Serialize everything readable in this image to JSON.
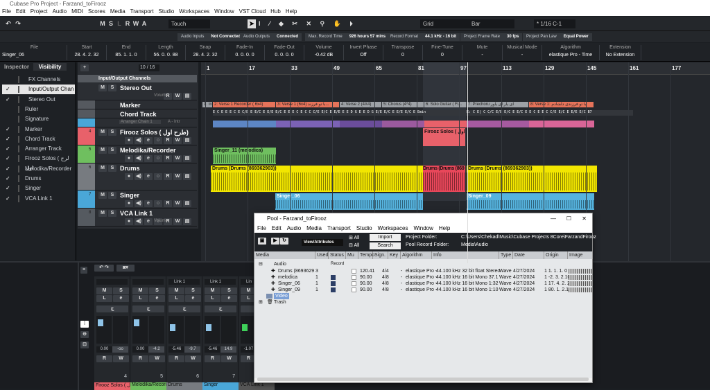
{
  "app": {
    "title": "Cubase Pro Project - Farzand_toFirooz"
  },
  "menu": [
    "File",
    "Edit",
    "Project",
    "Audio",
    "MIDI",
    "Scores",
    "Media",
    "Transport",
    "Studio",
    "Workspaces",
    "Window",
    "VST Cloud",
    "Hub",
    "Help"
  ],
  "toolbar": {
    "msl": [
      "M",
      "S",
      "L",
      "R",
      "W",
      "A"
    ],
    "automation_mode": "Touch",
    "snap_type": "Grid",
    "grid_type": "Bar",
    "quantize": "* 1/16  C-1"
  },
  "status": [
    {
      "label": "Audio Inputs",
      "value": "Not Connected"
    },
    {
      "label": "Audio Outputs",
      "value": "Connected"
    },
    {
      "label": "Max. Record Time",
      "value": "926 hours 57 mins"
    },
    {
      "label": "Record Format",
      "value": "44.1 kHz - 16 bit"
    },
    {
      "label": "Project Frame Rate",
      "value": "30 fps"
    },
    {
      "label": "Project Pan Law",
      "value": "Equal Power"
    }
  ],
  "infoline": [
    {
      "h": "File",
      "v": "Singer_06"
    },
    {
      "h": "Start",
      "v": "28. 4. 2. 32"
    },
    {
      "h": "End",
      "v": "85. 1. 1. 0"
    },
    {
      "h": "Length",
      "v": "56. 0. 0. 88"
    },
    {
      "h": "Snap",
      "v": "28. 4. 2. 32"
    },
    {
      "h": "Fade-In",
      "v": "0. 0. 0. 0"
    },
    {
      "h": "Fade-Out",
      "v": "0. 0. 0. 0"
    },
    {
      "h": "Volume",
      "v": "-0.42   dB"
    },
    {
      "h": "Invert Phase",
      "v": "Off"
    },
    {
      "h": "Transpose",
      "v": "0"
    },
    {
      "h": "Fine-Tune",
      "v": "0"
    },
    {
      "h": "Mute",
      "v": "-"
    },
    {
      "h": "Musical Mode",
      "v": "-"
    },
    {
      "h": "Algorithm",
      "v": "elastique Pro - Time"
    },
    {
      "h": "Extension",
      "v": "No Extension"
    }
  ],
  "left": {
    "tabs": [
      "Inspector",
      "Visibility"
    ],
    "items": [
      {
        "label": "FX Channels",
        "checked": false
      },
      {
        "label": "Input/Output Chan",
        "checked": true
      },
      {
        "label": "Stereo Out",
        "checked": true
      },
      {
        "label": "Ruler",
        "checked": false
      },
      {
        "label": "Signature",
        "checked": false
      },
      {
        "label": "Marker",
        "checked": true
      },
      {
        "label": "Chord Track",
        "checked": true
      },
      {
        "label": "Arranger Track",
        "checked": true
      },
      {
        "label": "Firooz Solos ( لرح اول",
        "checked": true
      },
      {
        "label": "Melodika/Recorder",
        "checked": true
      },
      {
        "label": "Drums",
        "checked": true
      },
      {
        "label": "Singer",
        "checked": true
      },
      {
        "label": "VCA Link 1",
        "checked": true
      }
    ]
  },
  "tracklist": {
    "counter": "10 / 16",
    "folder": "Input/Output Channels",
    "tracks": [
      {
        "name": "Stereo Out",
        "extra": "Volume"
      },
      {
        "name": "Marker"
      },
      {
        "name": "Chord Track"
      },
      {
        "name": "Arranger Chain 1",
        "extra": "A - Intr"
      },
      {
        "name": "Firooz Solos ( طرح اول)",
        "num": "4"
      },
      {
        "name": "Melodika/Recorder",
        "num": "5"
      },
      {
        "name": "Drums",
        "num": "6"
      },
      {
        "name": "Singer",
        "num": "7"
      },
      {
        "name": "VCA Link 1",
        "num": "8",
        "extra": "Volume"
      }
    ]
  },
  "ruler": [
    "1",
    "17",
    "33",
    "49",
    "65",
    "81",
    "97",
    "113",
    "129",
    "145",
    "161",
    "177"
  ],
  "arranger": [
    "1: In",
    "2: Verse 1 Recorder ( 6x4)",
    "3: Verse 1 (6x4)  با تو فرزند...",
    "4: Verse 2 (4X4)",
    "5: Chorus (4*4)",
    "6: Solo Guitar ( Fi...",
    "7: Prechoru   ای یار ای یاور",
    "8: Verse 1: با تو فرزندی دلشادم"
  ],
  "chords": "E C E E E C E C/E  E E/C E E/E  E/C E E E C E C C C/E  E/C E E/E  E E D G  E E D  G  E/E  E/C E E/E  E/C E Emin",
  "chords2": "E: C E| C C/C E/E  E/C E E/C E E C E E C C/E  E/C E E/E  E/C B7",
  "clips": {
    "firooz": "Firooz Solos ( ج اول",
    "melodika": "Singer_11 (melodica)",
    "drums1": "Drums (Drums (869362903))",
    "drums2": "Drums (Drums (869",
    "drums3": "Drums (Drums (869362903))",
    "singer1": "Singer_06",
    "singer2": "Singer_09"
  },
  "mixer": {
    "strips": [
      {
        "name": "Firooz Solos ( لرح اول",
        "vol": "0.00",
        "peak": "-oo",
        "num": "4",
        "link": "",
        "color": "#e8616a"
      },
      {
        "name": "Melodika/Recorder",
        "vol": "0.00",
        "peak": "-4.2",
        "num": "5",
        "link": "",
        "color": "#6fbf5f"
      },
      {
        "name": "Drums",
        "vol": "-5.46",
        "peak": "-9.7",
        "num": "6",
        "link": "Link 1",
        "color": "#777b80"
      },
      {
        "name": "Singer",
        "vol": "-5.46",
        "peak": "14.9",
        "num": "7",
        "link": "Link 1",
        "color": "#4aa7d8"
      },
      {
        "name": "VCA Link 1",
        "vol": "-1.07",
        "peak": "",
        "num": "",
        "link": "Lin",
        "color": "#555"
      }
    ]
  },
  "pool": {
    "title": "Pool - Farzand_toFirooz",
    "menu": [
      "File",
      "Edit",
      "Audio",
      "Media",
      "Transport",
      "Studio",
      "Workspaces",
      "Window",
      "Help"
    ],
    "view": "View/Attributes",
    "all1": "All",
    "all2": "All",
    "import": "Import",
    "search": "Search",
    "project_folder_label": "Project Folder:",
    "project_folder": "C:\\Users\\Chekad\\Music\\Cubase Projects 8Core\\FarzandFirooz",
    "record_folder_label": "Pool Record Folder:",
    "record_folder": "Media\\Audio",
    "columns": [
      "Media",
      "Used",
      "Status",
      "Mu",
      "Tempo",
      "Sign.",
      "Key",
      "Algorithm",
      "Info",
      "Type",
      "Date",
      "Origin Time",
      "Image"
    ],
    "audio_folder": "Audio",
    "record_label": "Record",
    "rows": [
      {
        "media": "Drums (8693629",
        "used": "3",
        "tempo": "120.41",
        "sign": "4/4",
        "key": "-",
        "alg": "elastique Pro -",
        "info": "44.100 kHz  32 bit float  Stereo",
        "type": "Wave",
        "date": "4/27/2024",
        "origin": "1  1. 1. 1.  0"
      },
      {
        "media": "melodica",
        "used": "1",
        "tempo": "90.00",
        "sign": "4/8",
        "key": "-",
        "alg": "elastique Pro -",
        "info": "44.100 kHz  16 bit  Mono  37.1",
        "type": "Wave",
        "date": "4/27/2024",
        "origin": "1  -2. 3. 2.105"
      },
      {
        "media": "Singer_06",
        "used": "1",
        "tempo": "90.00",
        "sign": "4/8",
        "key": "-",
        "alg": "elastique Pro -",
        "info": "44.100 kHz  16 bit  Mono  1:32",
        "type": "Wave",
        "date": "4/27/2024",
        "origin": "1  17. 4. 2. 21"
      },
      {
        "media": "Singer_09",
        "used": "1",
        "tempo": "90.00",
        "sign": "4/8",
        "key": "-",
        "alg": "elastique Pro -",
        "info": "44.100 kHz  16 bit  Mono  1:10",
        "type": "Wave",
        "date": "4/27/2024",
        "origin": "1  80. 1. 2.119"
      }
    ],
    "video_folder": "Video",
    "trash_folder": "Trash"
  }
}
